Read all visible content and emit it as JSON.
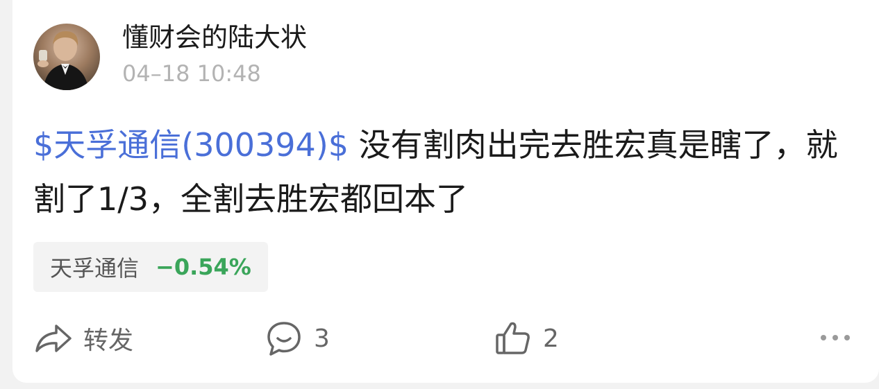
{
  "author": {
    "name": "懂财会的陆大状",
    "time": "04–18 10:48"
  },
  "post": {
    "stock_tag": "$天孚通信(300394)$",
    "text": " 没有割肉出完去胜宏真是瞎了，就割了1/3，全割去胜宏都回本了"
  },
  "stock_chip": {
    "name": "天孚通信",
    "change": "−0.54%"
  },
  "actions": {
    "share_label": "转发",
    "comment_count": "3",
    "like_count": "2"
  },
  "icons": {
    "share": "share-arrow-icon",
    "comment": "speech-bubble-icon",
    "like": "thumbs-up-icon",
    "more": "more-dots-icon"
  },
  "colors": {
    "link": "#4a6fd8",
    "positive_change": "#3aa55a"
  }
}
